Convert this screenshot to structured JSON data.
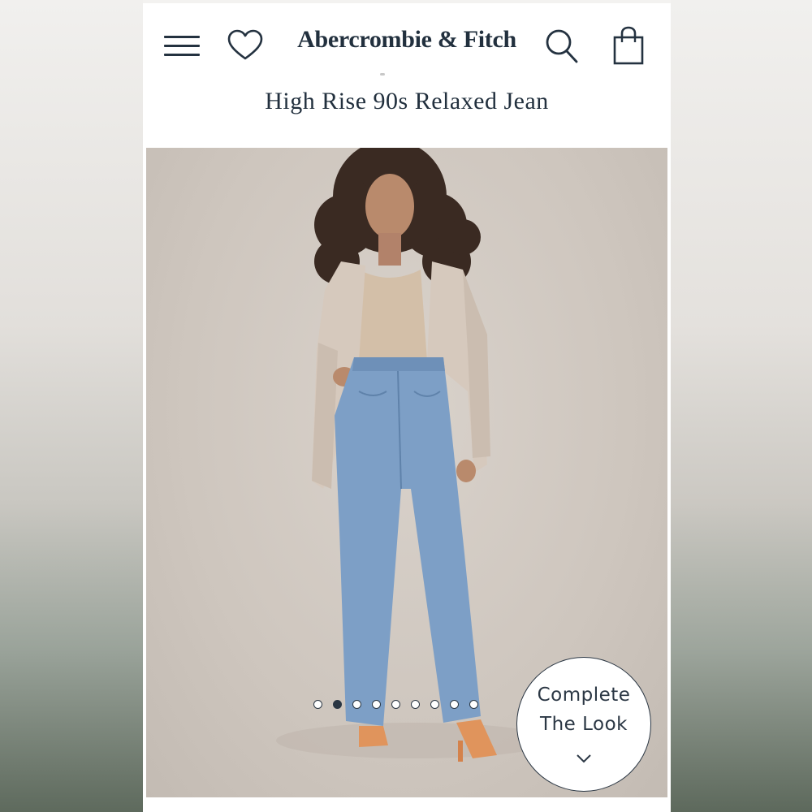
{
  "header": {
    "brand": "Abercrombie & Fitch",
    "icons": {
      "menu": "hamburger-menu-icon",
      "wishlist": "heart-icon",
      "search": "search-icon",
      "bag": "shopping-bag-icon"
    }
  },
  "product": {
    "title": "High Rise 90s Relaxed Jean"
  },
  "gallery": {
    "total_images": 9,
    "active_index": 2
  },
  "complete_look": {
    "line1": "Complete",
    "line2": "The Look",
    "icon": "chevron-down-icon"
  },
  "colors": {
    "brand_navy": "#22303e",
    "background": "#ffffff",
    "photo_backdrop": "#cec6be"
  }
}
